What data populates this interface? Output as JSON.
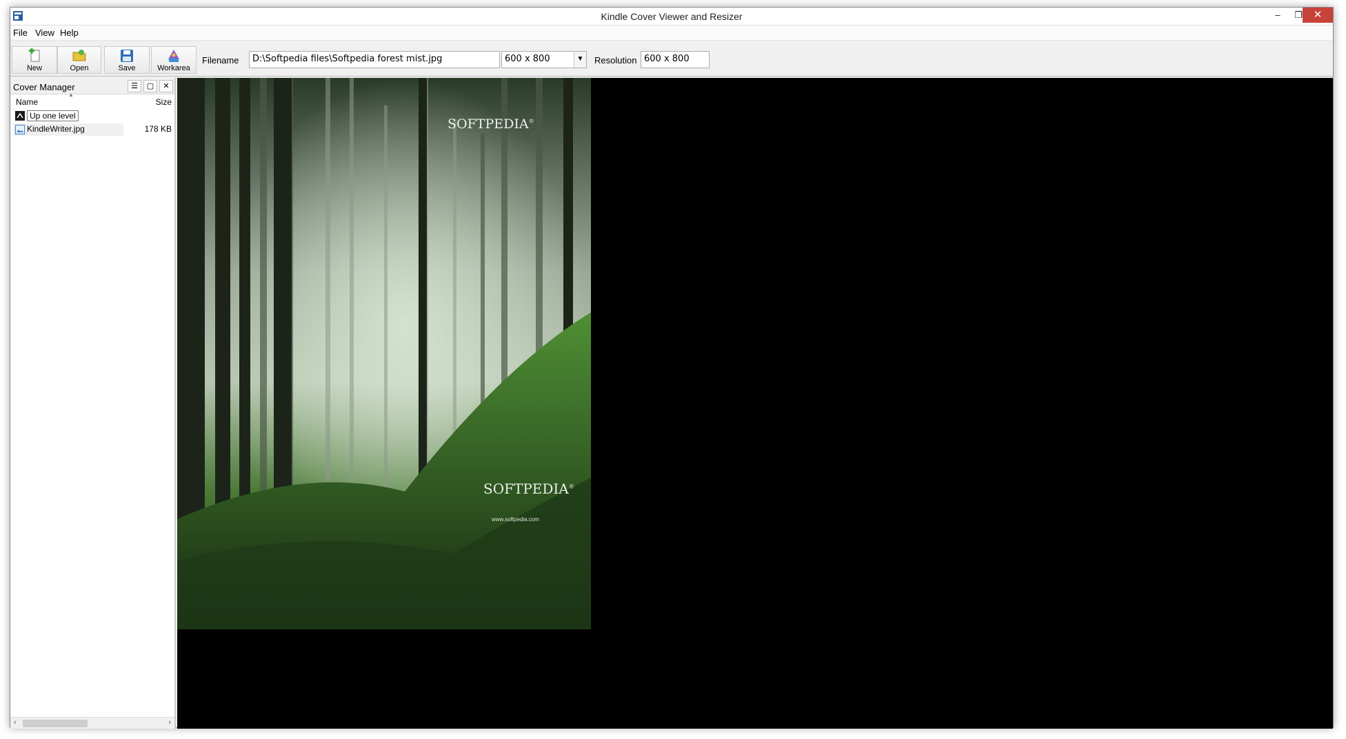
{
  "window": {
    "title": "Kindle Cover Viewer and Resizer",
    "minimize": "–",
    "maximize": "❐",
    "close": "✕"
  },
  "menu": {
    "items": [
      "File",
      "View",
      "Help"
    ]
  },
  "toolbar": {
    "buttons": [
      {
        "label": "New",
        "icon": "new-file-icon"
      },
      {
        "label": "Open",
        "icon": "open-folder-icon"
      },
      {
        "label": "Save",
        "icon": "save-disk-icon"
      },
      {
        "label": "Workarea",
        "icon": "workarea-icon"
      }
    ],
    "filename_label": "Filename",
    "filename_value": "D:\\Softpedia files\\Softpedia forest mist.jpg",
    "size_select_value": "600 x 800",
    "resolution_label": "Resolution",
    "resolution_value": "600 x 800"
  },
  "cover_manager": {
    "title": "Cover Manager",
    "columns": {
      "name": "Name",
      "size": "Size"
    },
    "rows": [
      {
        "name": "Up one level",
        "size": "",
        "icon": "up-level-icon"
      },
      {
        "name": "KindleWriter.jpg",
        "size": "178 KB",
        "icon": "image-file-icon"
      }
    ]
  },
  "preview": {
    "watermark_top": "SOFTPEDIA",
    "watermark_mid": "SOFTPEDIA",
    "watermark_url": "www.softpedia.com",
    "trademark": "®"
  },
  "colors": {
    "close_button": "#c7423b",
    "viewer_background": "#000000",
    "forest_dark": "#1d2a1a",
    "forest_green": "#3c7a2a",
    "mist": "#c9d3c6"
  }
}
